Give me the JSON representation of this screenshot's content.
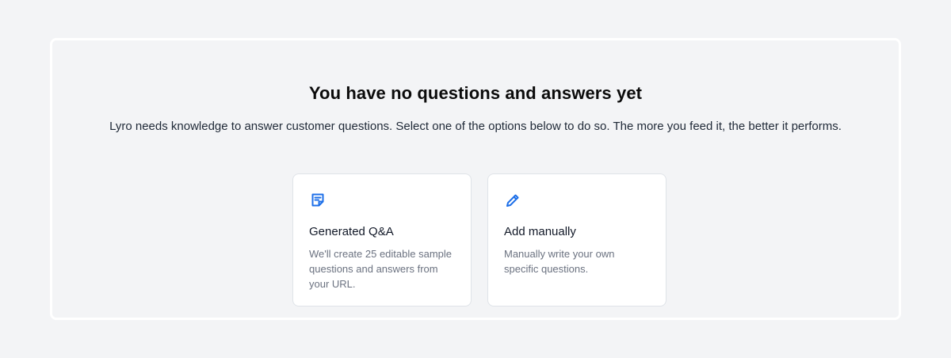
{
  "empty_state": {
    "title": "You have no questions and answers yet",
    "subtitle": "Lyro needs knowledge to answer customer questions. Select one of the options below to do so. The more you feed it, the better it performs."
  },
  "options": [
    {
      "icon": "document-list-icon",
      "title": "Generated Q&A",
      "description": "We'll create 25 editable sample questions and answers from your URL."
    },
    {
      "icon": "pencil-icon",
      "title": "Add manually",
      "description": "Manually write your own specific questions."
    }
  ],
  "colors": {
    "page_background": "#f3f4f6",
    "accent": "#1d6fe8",
    "muted_text": "#6b7280"
  }
}
